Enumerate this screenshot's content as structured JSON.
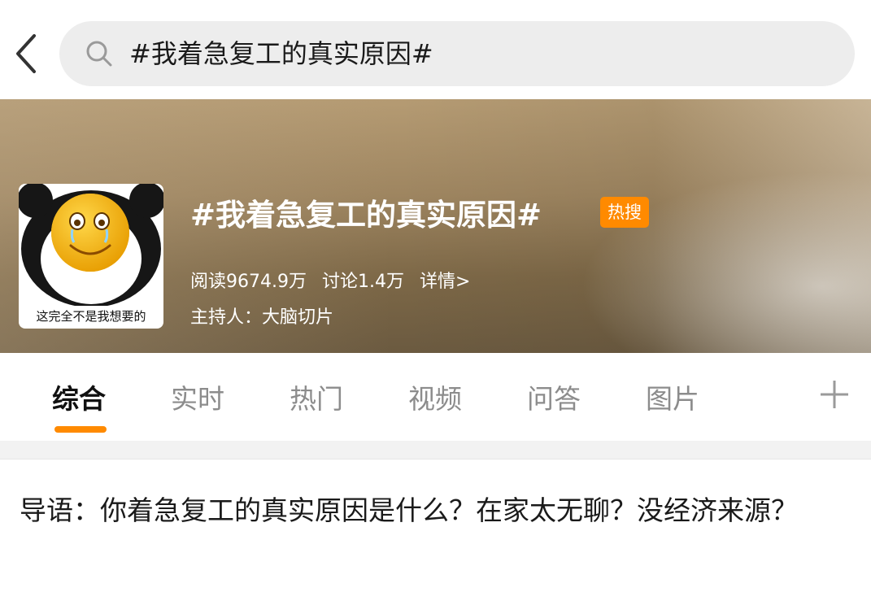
{
  "search": {
    "query": "#我着急复工的真实原因#"
  },
  "hero": {
    "title": "#我着急复工的真实原因#",
    "badge": "热搜",
    "reads": "阅读9674.9万",
    "discussions": "讨论1.4万",
    "details_link": "详情>",
    "host": "主持人：大脑切片",
    "avatar_caption": "这完全不是我想要的"
  },
  "tabs": [
    {
      "label": "综合",
      "active": true
    },
    {
      "label": "实时",
      "active": false
    },
    {
      "label": "热门",
      "active": false
    },
    {
      "label": "视频",
      "active": false
    },
    {
      "label": "问答",
      "active": false
    },
    {
      "label": "图片",
      "active": false
    }
  ],
  "intro": {
    "text": "导语：你着急复工的真实原因是什么？在家太无聊？没经济来源？"
  },
  "colors": {
    "accent": "#ff8a00",
    "search_bg": "#ededed",
    "active_tab": "#111111",
    "inactive_tab": "#8c8c8c"
  },
  "icons": {
    "back": "chevron-left-icon",
    "search": "search-icon",
    "add": "plus-icon"
  }
}
